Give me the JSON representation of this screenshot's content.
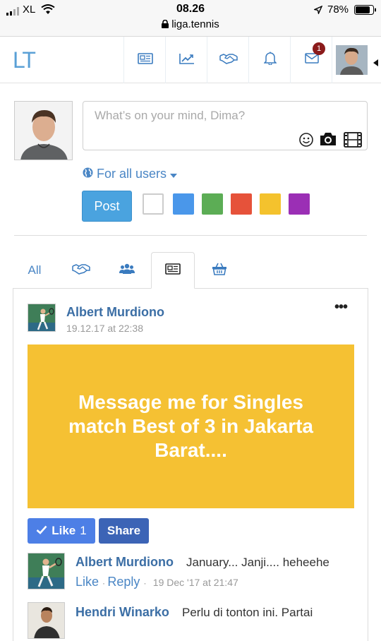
{
  "status": {
    "carrier": "XL",
    "time": "08.26",
    "url": "liga.tennis",
    "battery": "78%"
  },
  "nav": {
    "logo": "LT",
    "notifications_badge": "1",
    "icons": [
      "newspaper-icon",
      "chart-line-icon",
      "handshake-icon",
      "bell-icon",
      "envelope-icon"
    ]
  },
  "composer": {
    "placeholder": "What’s on your mind, Dima?",
    "audience_label": "For all users",
    "post_label": "Post",
    "colors": [
      "#ffffff",
      "#4a97ea",
      "#5cad55",
      "#e6523a",
      "#f4c22d",
      "#9b2fb5"
    ]
  },
  "tabs": {
    "all_label": "All"
  },
  "post": {
    "author": "Albert Murdiono",
    "date": "19.12.17 at 22:38",
    "banner_text": "Message me for Singles match Best of 3 in Jakarta Barat....",
    "banner_color": "#f5c133",
    "like_label": "Like",
    "like_count": "1",
    "share_label": "Share",
    "comments": [
      {
        "author": "Albert Murdiono",
        "text": "January... Janji.... heheehe",
        "like": "Like",
        "reply": "Reply",
        "time": "19 Dec '17 at 21:47"
      },
      {
        "author": "Hendri Winarko",
        "text": "Perlu di tonton ini. Partai"
      }
    ]
  }
}
